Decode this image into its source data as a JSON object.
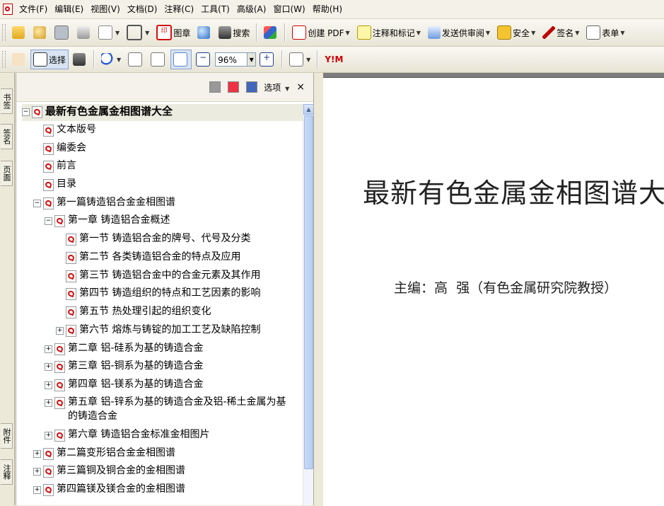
{
  "menu": [
    "文件(F)",
    "编辑(E)",
    "视图(V)",
    "文档(D)",
    "注释(C)",
    "工具(T)",
    "高级(A)",
    "窗口(W)",
    "帮助(H)"
  ],
  "toolbar1": {
    "stamp_label": "图章",
    "search_label": "搜索",
    "create_pdf_label": "创建 PDF",
    "comment_label": "注释和标记",
    "send_review_label": "发送供审阅",
    "security_label": "安全",
    "sign_label": "签名",
    "form_label": "表单"
  },
  "toolbar2": {
    "select_label": "选择",
    "zoom_value": "96%",
    "yahoo_label": "Y!M"
  },
  "left_tabs": [
    "书签",
    "签名",
    "页面",
    "附件",
    "注释"
  ],
  "panel": {
    "options_label": "选项",
    "close_label": "×"
  },
  "bookmarks": [
    {
      "level": 0,
      "expander": "minus",
      "text": "最新有色金属金相图谱大全",
      "bold": true
    },
    {
      "level": 1,
      "expander": "",
      "text": "文本版号"
    },
    {
      "level": 1,
      "expander": "",
      "text": "编委会"
    },
    {
      "level": 1,
      "expander": "",
      "text": "前言"
    },
    {
      "level": 1,
      "expander": "",
      "text": "目录"
    },
    {
      "level": 1,
      "expander": "minus",
      "text": "第一篇铸造铝合金金相图谱"
    },
    {
      "level": 2,
      "expander": "minus",
      "text": "第一章 铸造铝合金概述"
    },
    {
      "level": 3,
      "expander": "",
      "text": "第一节 铸造铝合金的牌号、代号及分类"
    },
    {
      "level": 3,
      "expander": "",
      "text": "第二节 各类铸造铝合金的特点及应用"
    },
    {
      "level": 3,
      "expander": "",
      "text": "第三节 铸造铝合金中的合金元素及其作用"
    },
    {
      "level": 3,
      "expander": "",
      "text": "第四节 铸造组织的特点和工艺因素的影响"
    },
    {
      "level": 3,
      "expander": "",
      "text": "第五节 热处理引起的组织变化"
    },
    {
      "level": 3,
      "expander": "plus",
      "text": "第六节 熔炼与铸锭的加工工艺及缺陷控制"
    },
    {
      "level": 2,
      "expander": "plus",
      "text": "第二章 铝-硅系为基的铸造合金"
    },
    {
      "level": 2,
      "expander": "plus",
      "text": "第三章 铝-铜系为基的铸造合金"
    },
    {
      "level": 2,
      "expander": "plus",
      "text": "第四章 铝-镁系为基的铸造合金"
    },
    {
      "level": 2,
      "expander": "plus",
      "text": "第五章 铝-锌系为基的铸造合金及铝-稀土金属为基",
      "text2": "的铸造合金"
    },
    {
      "level": 2,
      "expander": "plus",
      "text": "第六章 铸造铝合金标准金相图片"
    },
    {
      "level": 1,
      "expander": "plus",
      "text": "第二篇变形铝合金金相图谱"
    },
    {
      "level": 1,
      "expander": "plus",
      "text": "第三篇铜及铜合金的金相图谱"
    },
    {
      "level": 1,
      "expander": "plus",
      "text": "第四篇镁及镁合金的金相图谱"
    }
  ],
  "document": {
    "title": "最新有色金属金相图谱大全",
    "subtitle": "主编：高  强（有色金属研究院教授）"
  }
}
